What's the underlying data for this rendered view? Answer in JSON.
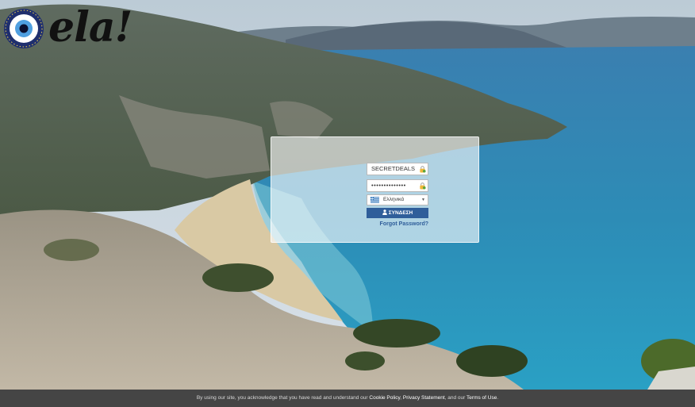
{
  "brand": {
    "name": "ela!"
  },
  "login": {
    "username_value": "SECRETDEALS",
    "password_value": "••••••••••••••",
    "language_selected": "Ελληνικά",
    "submit_label": "ΣΥΝΔΕΣΗ",
    "forgot_password_label": "Forgot Password?"
  },
  "icons": {
    "username_field": "lock-icon",
    "password_field": "lock-icon",
    "language_flag": "greek-flag-icon",
    "submit": "user-icon"
  },
  "footer": {
    "text_prefix": "By using our site, you acknowledge that you have read and understand our",
    "cookie_policy": "Cookie Policy",
    "separator": ",",
    "privacy_statement": "Privacy Statement",
    "text_middle": ", and our",
    "terms_of_use": "Terms of Use",
    "text_suffix": "."
  },
  "colors": {
    "primary_button": "#2f5e9a",
    "footer_bg": "#454545",
    "sea": "#2f8fb8"
  }
}
